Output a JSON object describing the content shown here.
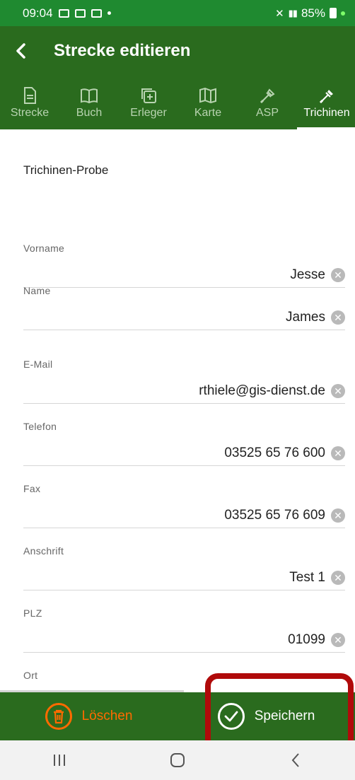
{
  "status_bar": {
    "time": "09:04",
    "battery": "85%"
  },
  "app_bar": {
    "title": "Strecke editieren"
  },
  "tabs": [
    {
      "label": "Strecke",
      "icon": "document-icon"
    },
    {
      "label": "Buch",
      "icon": "book-icon"
    },
    {
      "label": "Erleger",
      "icon": "add-copy-icon"
    },
    {
      "label": "Karte",
      "icon": "map-icon"
    },
    {
      "label": "ASP",
      "icon": "pipette-icon"
    },
    {
      "label": "Trichinen",
      "icon": "pipette-icon"
    }
  ],
  "active_tab": "Trichinen",
  "section_title": "Trichinen-Probe",
  "fields": [
    {
      "label": "Vorname",
      "value": "Jesse"
    },
    {
      "label": "Name",
      "value": "James"
    },
    {
      "label": "E-Mail",
      "value": "rthiele@gis-dienst.de"
    },
    {
      "label": "Telefon",
      "value": "03525 65 76 600"
    },
    {
      "label": "Fax",
      "value": "03525 65 76 609"
    },
    {
      "label": "Anschrift",
      "value": "Test 1"
    },
    {
      "label": "PLZ",
      "value": "01099"
    },
    {
      "label": "Ort",
      "value": ""
    }
  ],
  "actions": {
    "delete_label": "Löschen",
    "save_label": "Speichern"
  },
  "colors": {
    "status_bar": "#1f8a30",
    "app_green": "#2a6b1e",
    "delete_orange": "#ff6a00",
    "highlight_red": "#b00a0a"
  }
}
